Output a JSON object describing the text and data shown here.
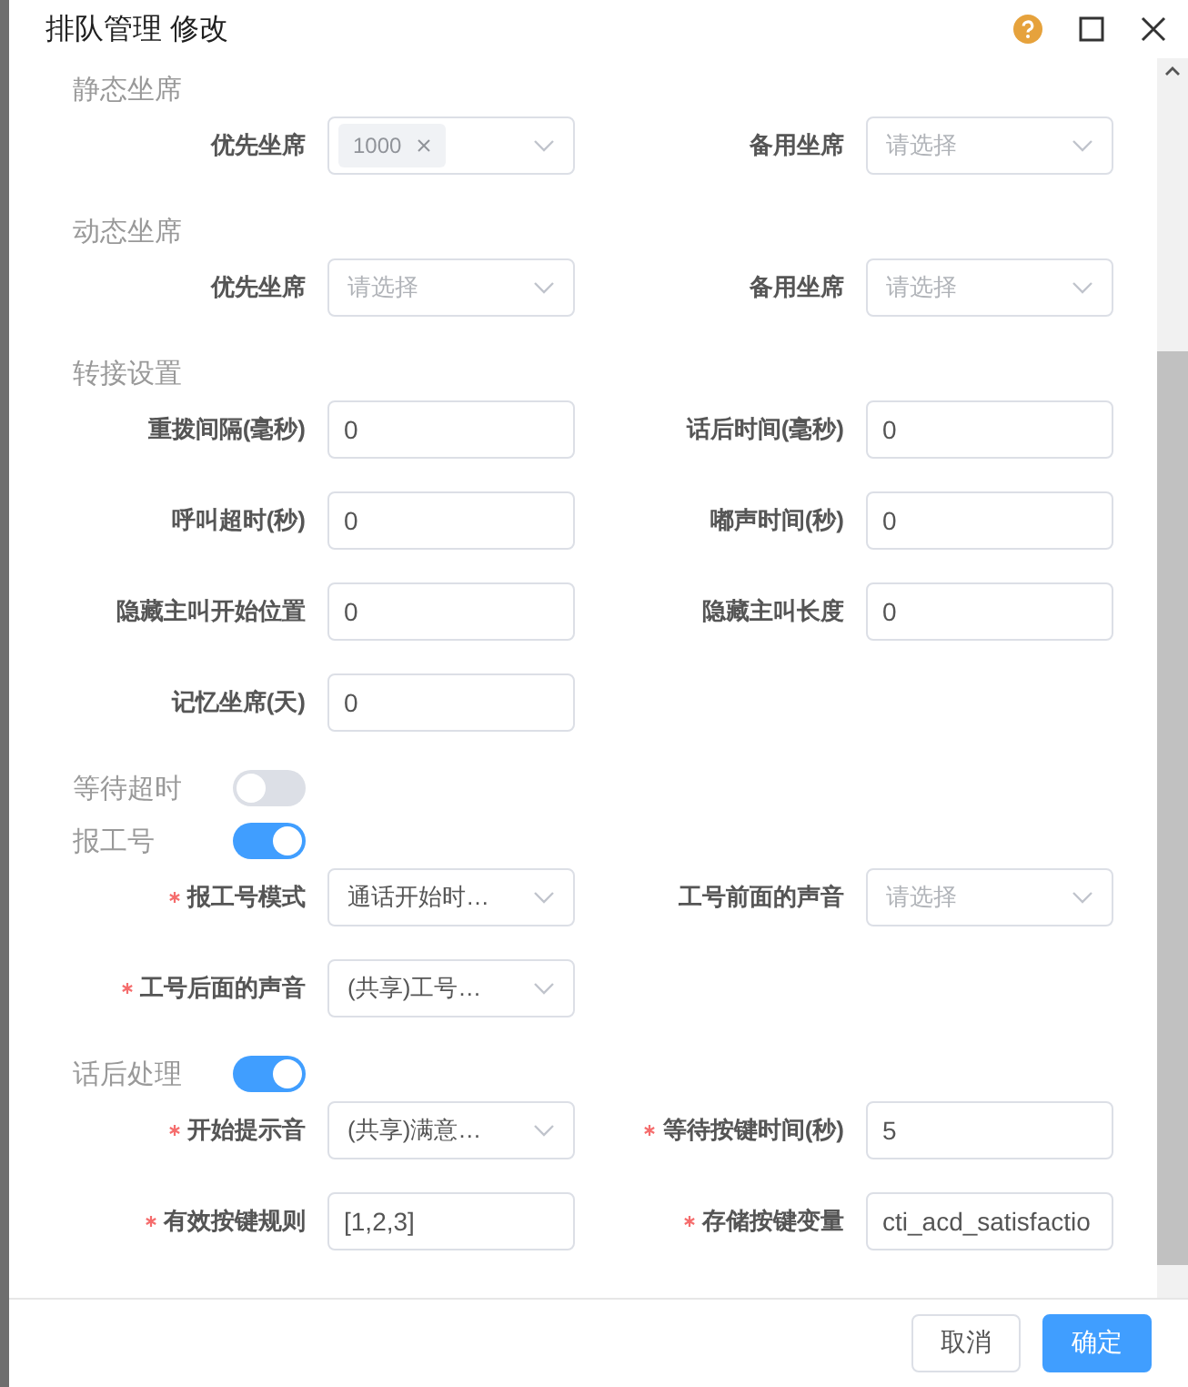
{
  "dialog": {
    "title": "排队管理 修改"
  },
  "sections": [
    {
      "kind": "heading",
      "title": "静态坐席",
      "rows": [
        [
          {
            "label": "优先坐席",
            "required": false,
            "kind": "tags",
            "tags": [
              "1000"
            ]
          },
          {
            "label": "备用坐席",
            "required": false,
            "kind": "select",
            "placeholder": "请选择"
          }
        ]
      ]
    },
    {
      "kind": "heading",
      "title": "动态坐席",
      "rows": [
        [
          {
            "label": "优先坐席",
            "required": false,
            "kind": "select",
            "placeholder": "请选择"
          },
          {
            "label": "备用坐席",
            "required": false,
            "kind": "select",
            "placeholder": "请选择"
          }
        ]
      ]
    },
    {
      "kind": "heading",
      "title": "转接设置",
      "rows": [
        [
          {
            "label": "重拨间隔(毫秒)",
            "required": false,
            "kind": "input",
            "value": "0"
          },
          {
            "label": "话后时间(毫秒)",
            "required": false,
            "kind": "input",
            "value": "0"
          }
        ],
        [
          {
            "label": "呼叫超时(秒)",
            "required": false,
            "kind": "input",
            "value": "0"
          },
          {
            "label": "嘟声时间(秒)",
            "required": false,
            "kind": "input",
            "value": "0"
          }
        ],
        [
          {
            "label": "隐藏主叫开始位置",
            "required": false,
            "kind": "input",
            "value": "0"
          },
          {
            "label": "隐藏主叫长度",
            "required": false,
            "kind": "input",
            "value": "0"
          }
        ],
        [
          {
            "label": "记忆坐席(天)",
            "required": false,
            "kind": "input",
            "value": "0"
          }
        ]
      ]
    },
    {
      "kind": "switch",
      "title": "等待超时",
      "on": false
    },
    {
      "kind": "switch",
      "title": "报工号",
      "on": true,
      "rows": [
        [
          {
            "label": "报工号模式",
            "required": true,
            "kind": "select",
            "value": "通话开始时…"
          },
          {
            "label": "工号前面的声音",
            "required": false,
            "kind": "select",
            "placeholder": "请选择"
          }
        ],
        [
          {
            "label": "工号后面的声音",
            "required": true,
            "kind": "select",
            "value": "(共享)工号…"
          }
        ]
      ]
    },
    {
      "kind": "switch",
      "title": "话后处理",
      "on": true,
      "rows": [
        [
          {
            "label": "开始提示音",
            "required": true,
            "kind": "select",
            "value": "(共享)满意…"
          },
          {
            "label": "等待按键时间(秒)",
            "required": true,
            "kind": "input",
            "value": "5"
          }
        ],
        [
          {
            "label": "有效按键规则",
            "required": true,
            "kind": "input",
            "value": "[1,2,3]"
          },
          {
            "label": "存储按键变量",
            "required": true,
            "kind": "input",
            "value": "cti_acd_satisfactio"
          }
        ]
      ]
    }
  ],
  "footer": {
    "buttons": [
      {
        "label": "取消",
        "kind": "default"
      },
      {
        "label": "确定",
        "kind": "primary"
      }
    ]
  }
}
